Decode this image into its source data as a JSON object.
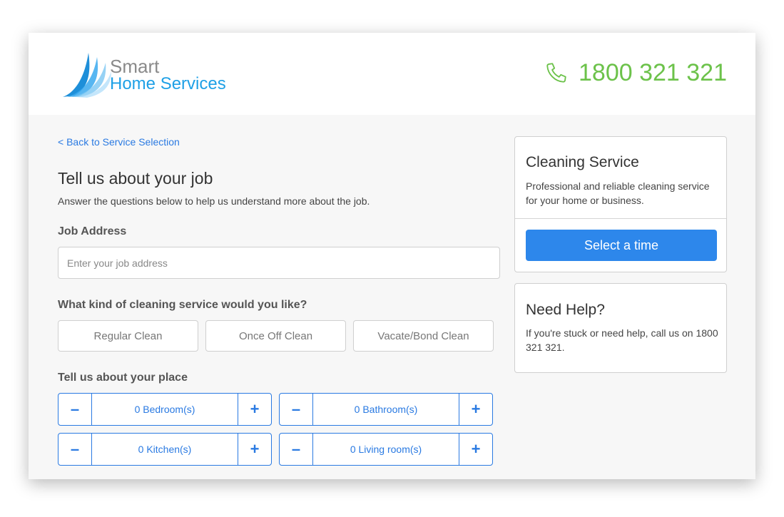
{
  "brand": {
    "name_line1": "Smart",
    "name_line2": "Home Services"
  },
  "header": {
    "phone": "1800 321 321"
  },
  "nav": {
    "back_link": "< Back to Service Selection"
  },
  "form": {
    "title": "Tell us about your job",
    "subtitle": "Answer the questions below to help us understand more about the job.",
    "address": {
      "label": "Job Address",
      "placeholder": "Enter your job address",
      "value": ""
    },
    "service_kind": {
      "label": "What kind of cleaning service would you like?",
      "options": [
        "Regular Clean",
        "Once Off Clean",
        "Vacate/Bond Clean"
      ]
    },
    "place": {
      "label": "Tell us about your place",
      "steppers": [
        {
          "value": "0 Bedroom(s)"
        },
        {
          "value": "0 Bathroom(s)"
        },
        {
          "value": "0 Kitchen(s)"
        },
        {
          "value": "0 Living room(s)"
        }
      ],
      "minus": "–",
      "plus": "+"
    }
  },
  "sidebar": {
    "service_card": {
      "title": "Cleaning Service",
      "description": "Professional and reliable cleaning service for your home or business.",
      "button": "Select a time"
    },
    "help_card": {
      "title": "Need Help?",
      "text": "If you're stuck or need help, call us on 1800 321 321."
    }
  },
  "colors": {
    "accent": "#2a7ae2",
    "phone": "#6cc24a",
    "brand_blue": "#1ea0e6",
    "button": "#2d87eb"
  },
  "icons": {
    "phone": "phone-icon",
    "logo": "logo-wing-icon"
  }
}
